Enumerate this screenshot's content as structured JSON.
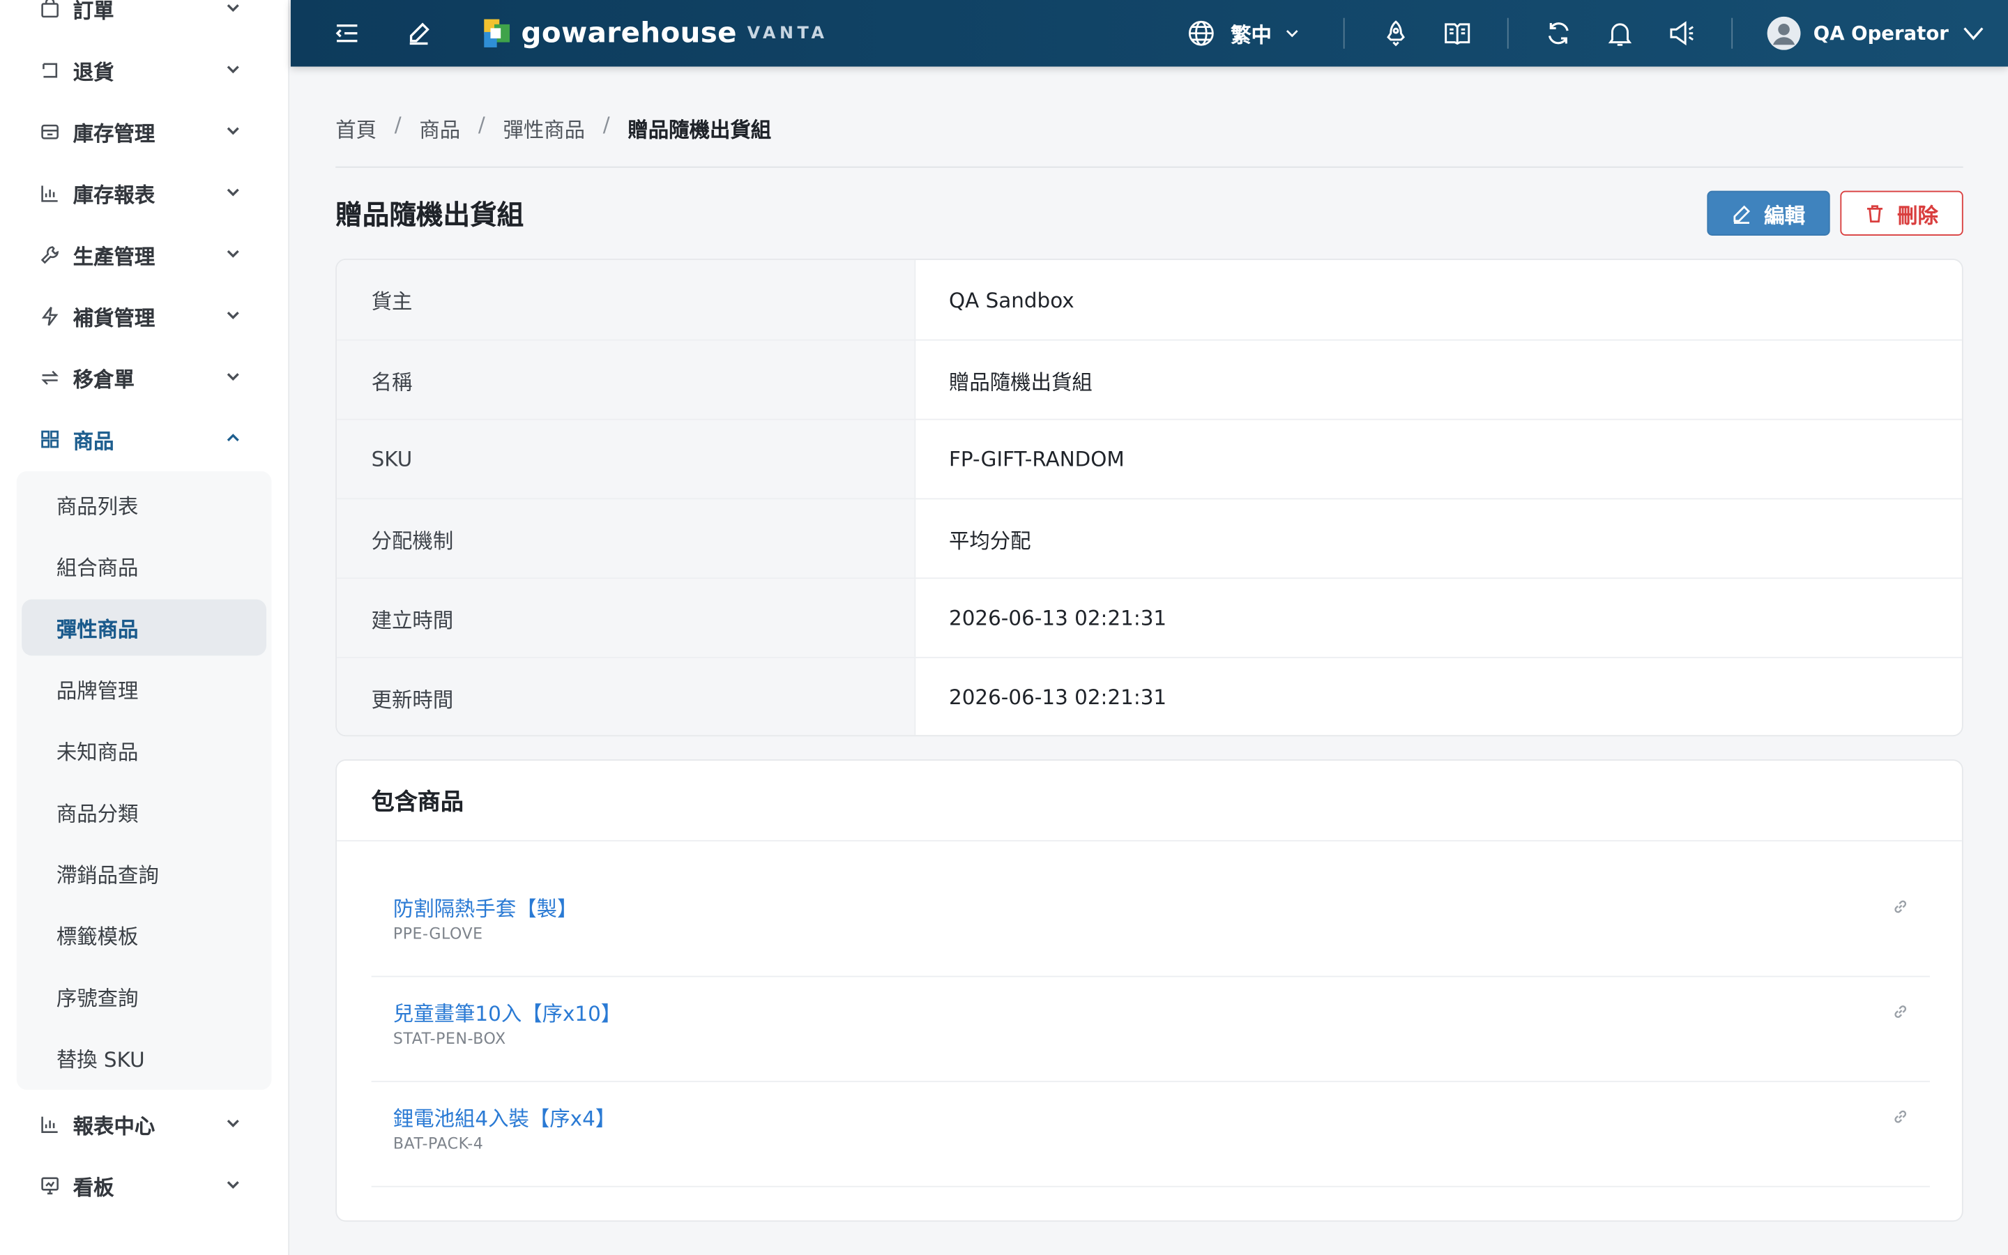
{
  "sidebar": {
    "items": [
      {
        "label": "訂單",
        "icon": "bag-icon"
      },
      {
        "label": "退貨",
        "icon": "return-icon"
      },
      {
        "label": "庫存管理",
        "icon": "inventory-box-icon"
      },
      {
        "label": "庫存報表",
        "icon": "bar-chart-icon"
      },
      {
        "label": "生產管理",
        "icon": "wrench-icon"
      },
      {
        "label": "補貨管理",
        "icon": "lightning-icon"
      },
      {
        "label": "移倉單",
        "icon": "transfer-icon"
      },
      {
        "label": "商品",
        "icon": "grid-icon"
      }
    ],
    "submenu": [
      {
        "label": "商品列表"
      },
      {
        "label": "組合商品"
      },
      {
        "label": "彈性商品"
      },
      {
        "label": "品牌管理"
      },
      {
        "label": "未知商品"
      },
      {
        "label": "商品分類"
      },
      {
        "label": "滯銷品查詢"
      },
      {
        "label": "標籤模板"
      },
      {
        "label": "序號查詢"
      },
      {
        "label": "替換 SKU"
      }
    ],
    "bottom": [
      {
        "label": "報表中心",
        "icon": "bar-chart-icon"
      },
      {
        "label": "看板",
        "icon": "dashboard-icon"
      }
    ]
  },
  "topbar": {
    "logo_word": "gowarehouse",
    "logo_sub": "VANTA",
    "language": "繁中",
    "user_name": "QA Operator"
  },
  "breadcrumb": [
    "首頁",
    "商品",
    "彈性商品",
    "贈品隨機出貨組"
  ],
  "page": {
    "title": "贈品隨機出貨組",
    "edit_label": "編輯",
    "delete_label": "刪除"
  },
  "details": [
    {
      "key": "貨主",
      "value": "QA Sandbox"
    },
    {
      "key": "名稱",
      "value": "贈品隨機出貨組"
    },
    {
      "key": "SKU",
      "value": "FP-GIFT-RANDOM"
    },
    {
      "key": "分配機制",
      "value": "平均分配"
    },
    {
      "key": "建立時間",
      "value": "2026-06-13 02:21:31"
    },
    {
      "key": "更新時間",
      "value": "2026-06-13 02:21:31"
    }
  ],
  "included": {
    "title": "包含商品",
    "products": [
      {
        "name": "防割隔熱手套【製】",
        "sku": "PPE-GLOVE"
      },
      {
        "name": "兒童畫筆10入【序x10】",
        "sku": "STAT-PEN-BOX"
      },
      {
        "name": "鋰電池組4入裝【序x4】",
        "sku": "BAT-PACK-4"
      }
    ]
  },
  "colors": {
    "topbar": "#0d3b5c",
    "primary": "#3f83be",
    "danger": "#d93e3e",
    "link": "#2a7ad4"
  }
}
